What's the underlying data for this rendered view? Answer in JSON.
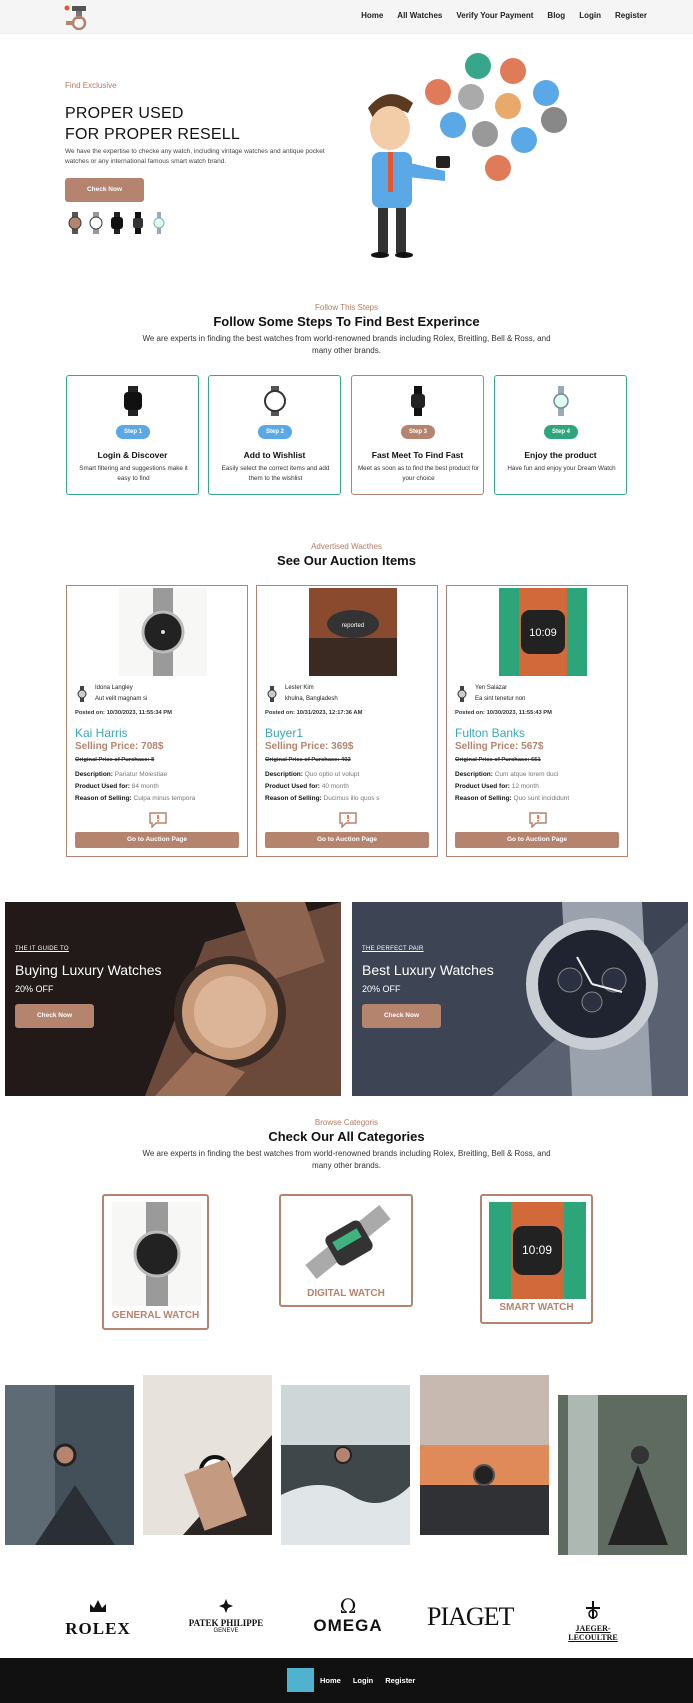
{
  "nav": {
    "items": [
      "Home",
      "All Watches",
      "Verify Your Payment",
      "Blog",
      "Login",
      "Register"
    ]
  },
  "hero": {
    "kicker": "Find Exclusive",
    "title_line1": "PROPER USED",
    "title_line2": "FOR PROPER RESELL",
    "description": "We have the expertise to checke any watch, including vintage watches and antique pocket watches or any international famous smart watch brand.",
    "button": "Check Now"
  },
  "steps_section": {
    "kicker": "Follow This Steps",
    "title": "Follow Some Steps To Find Best Experince",
    "description": "We are experts in finding the best watches from world-renowned brands including Rolex, Breitling, Bell & Ross, and many other brands.",
    "steps": [
      {
        "badge": "Step 1",
        "title": "Login & Discover",
        "desc": "Smart filtering and suggestions make it easy to find",
        "color": "#5aa9e6"
      },
      {
        "badge": "Step 2",
        "title": "Add to Wishlist",
        "desc": "Easily select the correct items and add them to the wishlist",
        "color": "#5aa9e6"
      },
      {
        "badge": "Step 3",
        "title": "Fast Meet To Find Fast",
        "desc": "Meet as soon as to find the best product for your choice",
        "color": "#b4846f"
      },
      {
        "badge": "Step 4",
        "title": "Enjoy the product",
        "desc": "Have fun and enjoy your Dream Watch",
        "color": "#2fa57e"
      }
    ]
  },
  "auction_section": {
    "kicker": "Advertised Wacthes",
    "title": "See Our Auction Items",
    "labels": {
      "posted": "Posted on:",
      "original": "Original Price of Purchase:",
      "selling": "Selling Price:",
      "description": "Description:",
      "used_for": "Product Used for:",
      "reason": "Reason of Selling:"
    },
    "button": "Go to Auction Page",
    "items": [
      {
        "seller": "Idona Langley",
        "location": "Aut velit magnam si",
        "posted": "10/30/2023, 11:55:34 PM",
        "title": "Kai Harris",
        "price": "708$",
        "original": "8",
        "description": "Pariatur Molestiae",
        "used_for": "84 month",
        "reason": "Culpa minus tempora"
      },
      {
        "seller": "Lester Kim",
        "location": "khulna, Bangladesh",
        "posted": "10/31/2023, 12:17:36 AM",
        "title": "Buyer1",
        "price": "369$",
        "original": "402",
        "description": "Quo optio ut volupt",
        "used_for": "40 month",
        "reason": "Ducimus illo quos s"
      },
      {
        "seller": "Yen Salazar",
        "location": "Ea sint tenetur non",
        "posted": "10/30/2023, 11:55:43 PM",
        "title": "Fulton Banks",
        "price": "567$",
        "original": "651",
        "description": "Cum atque lorem duci",
        "used_for": "12 month",
        "reason": "Quo sunt incididunt"
      }
    ]
  },
  "banners": [
    {
      "small": "THE IT GUIDE TO",
      "title": "Buying Luxury Watches",
      "off": "20% OFF",
      "button": "Check Now"
    },
    {
      "small": "THE PERFECT PAIR",
      "title": "Best Luxury Watches",
      "off": "20% OFF",
      "button": "Check Now"
    }
  ],
  "categories_section": {
    "kicker": "Browse Categoris",
    "title": "Check Our All Categories",
    "description": "We are experts in finding the best watches from world-renowned brands including Rolex, Breitling, Bell & Ross, and many other brands.",
    "items": [
      "GENERAL WATCH",
      "DIGITAL WATCH",
      "SMART WATCH"
    ]
  },
  "brands": {
    "rolex": "ROLEX",
    "patek_1": "PATEK PHILIPPE",
    "patek_2": "GENEVE",
    "omega_symbol": "Ω",
    "omega": "OMEGA",
    "piaget": "PIAGET",
    "jaeger": "JAEGER-LECOULTRE"
  },
  "footer": {
    "items": [
      "Home",
      "Login",
      "Register"
    ]
  },
  "colors": {
    "accent": "#b4846f",
    "teal": "#37a68a",
    "link": "#39a8b6"
  }
}
